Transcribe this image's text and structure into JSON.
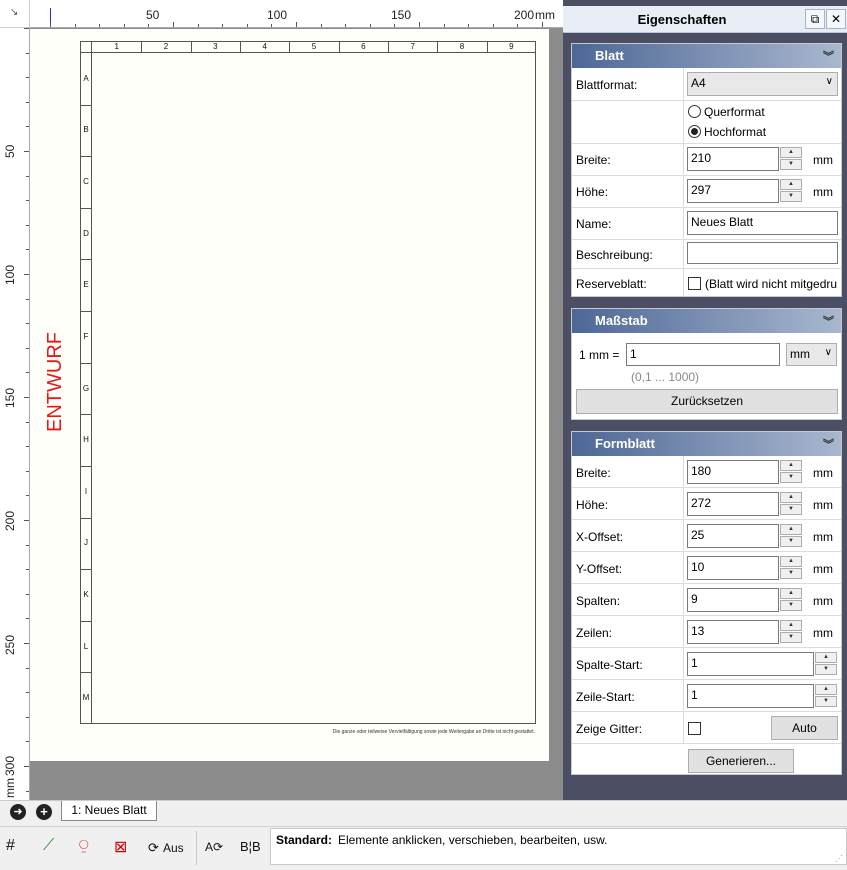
{
  "ruler": {
    "h_labels": [
      "50",
      "100",
      "150",
      "200"
    ],
    "h_unit": "mm",
    "v_labels": [
      "50",
      "100",
      "150",
      "200",
      "250",
      "300"
    ],
    "v_unit": "mm"
  },
  "sheet": {
    "columns": [
      "1",
      "2",
      "3",
      "4",
      "5",
      "6",
      "7",
      "8",
      "9"
    ],
    "rows": [
      "A",
      "B",
      "C",
      "D",
      "E",
      "F",
      "G",
      "H",
      "I",
      "J",
      "K",
      "L",
      "M"
    ],
    "watermark": "ENTWURF",
    "footer_note": "Die ganze oder teilweise Vervielfältigung sowie jede Weitergabe an Dritte ist nicht gestattet."
  },
  "panel": {
    "title": "Eigenschaften",
    "blatt": {
      "header": "Blatt",
      "format_label": "Blattformat:",
      "format_value": "A4",
      "landscape": "Querformat",
      "portrait": "Hochformat",
      "orientation": "Hochformat",
      "width_label": "Breite:",
      "width_value": "210",
      "height_label": "Höhe:",
      "height_value": "297",
      "unit": "mm",
      "name_label": "Name:",
      "name_value": "Neues Blatt",
      "desc_label": "Beschreibung:",
      "desc_value": "",
      "reserve_label": "Reserveblatt:",
      "reserve_text": "(Blatt wird nicht mitgedru"
    },
    "massstab": {
      "header": "Maßstab",
      "label": "1 mm =",
      "value": "1",
      "unit": "mm",
      "range": "(0,1 ... 1000)",
      "reset": "Zurücksetzen"
    },
    "formblatt": {
      "header": "Formblatt",
      "fields": [
        {
          "label": "Breite:",
          "value": "180",
          "unit": "mm"
        },
        {
          "label": "Höhe:",
          "value": "272",
          "unit": "mm"
        },
        {
          "label": "X-Offset:",
          "value": "25",
          "unit": "mm"
        },
        {
          "label": "Y-Offset:",
          "value": "10",
          "unit": "mm"
        },
        {
          "label": "Spalten:",
          "value": "9",
          "unit": "mm"
        },
        {
          "label": "Zeilen:",
          "value": "13",
          "unit": "mm"
        },
        {
          "label": "Spalte-Start:",
          "value": "1",
          "unit": ""
        },
        {
          "label": "Zeile-Start:",
          "value": "1",
          "unit": ""
        }
      ],
      "grid_label": "Zeige Gitter:",
      "auto": "Auto",
      "generate": "Generieren..."
    }
  },
  "tabs": {
    "active": "1: Neues Blatt"
  },
  "toolbar": {
    "aus_label": "Aus"
  },
  "status": {
    "mode": "Standard:",
    "text": "Elemente anklicken, verschieben, bearbeiten, usw."
  },
  "colors": {
    "watermark": "#e81818",
    "section_header": "#4d6795",
    "canvas_bg": "#8c8c8c"
  }
}
